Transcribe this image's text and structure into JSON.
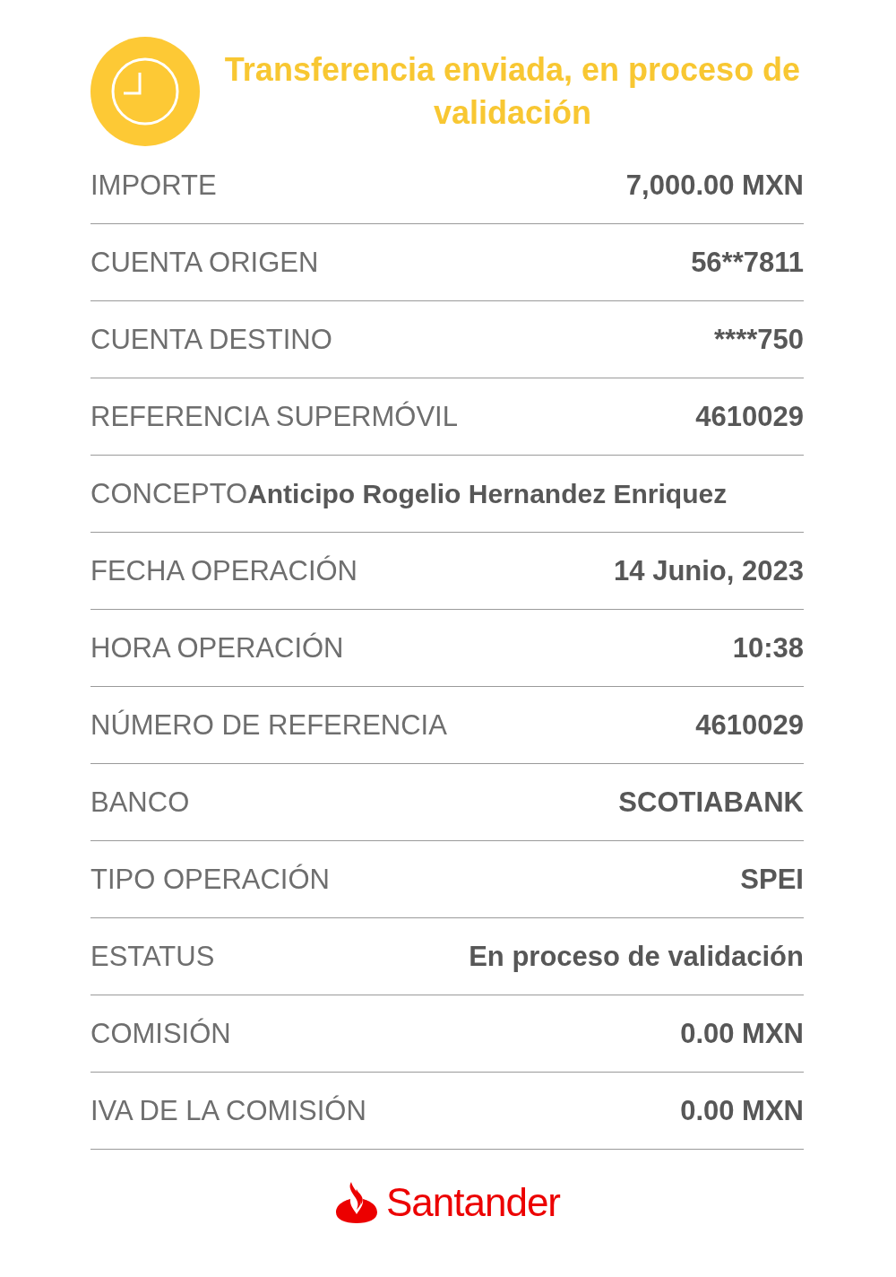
{
  "header": {
    "title": "Transferencia enviada, en proceso de validación"
  },
  "rows": [
    {
      "kind": "split",
      "label": "IMPORTE",
      "value": "7,000.00 MXN"
    },
    {
      "kind": "split",
      "label": "CUENTA ORIGEN",
      "value": "56**7811"
    },
    {
      "kind": "split",
      "label": "CUENTA DESTINO",
      "value": "****750"
    },
    {
      "kind": "split",
      "label": "REFERENCIA SUPERMÓVIL",
      "value": "4610029"
    },
    {
      "kind": "inline",
      "label": "CONCEPTO",
      "value": "Anticipo Rogelio Hernandez Enriquez"
    },
    {
      "kind": "split",
      "label": "FECHA OPERACIÓN",
      "value": "14 Junio, 2023"
    },
    {
      "kind": "split",
      "label": "HORA OPERACIÓN",
      "value": "10:38"
    },
    {
      "kind": "split",
      "label": "NÚMERO DE REFERENCIA",
      "value": "4610029"
    },
    {
      "kind": "split",
      "label": "BANCO",
      "value": "SCOTIABANK"
    },
    {
      "kind": "split",
      "label": "TIPO OPERACIÓN",
      "value": "SPEI"
    },
    {
      "kind": "split",
      "label": "ESTATUS",
      "value": "En proceso de validación"
    },
    {
      "kind": "split",
      "label": "COMISIÓN",
      "value": "0.00 MXN"
    },
    {
      "kind": "split",
      "label": "IVA DE LA COMISIÓN",
      "value": "0.00 MXN"
    }
  ],
  "footer": {
    "brand": "Santander"
  }
}
